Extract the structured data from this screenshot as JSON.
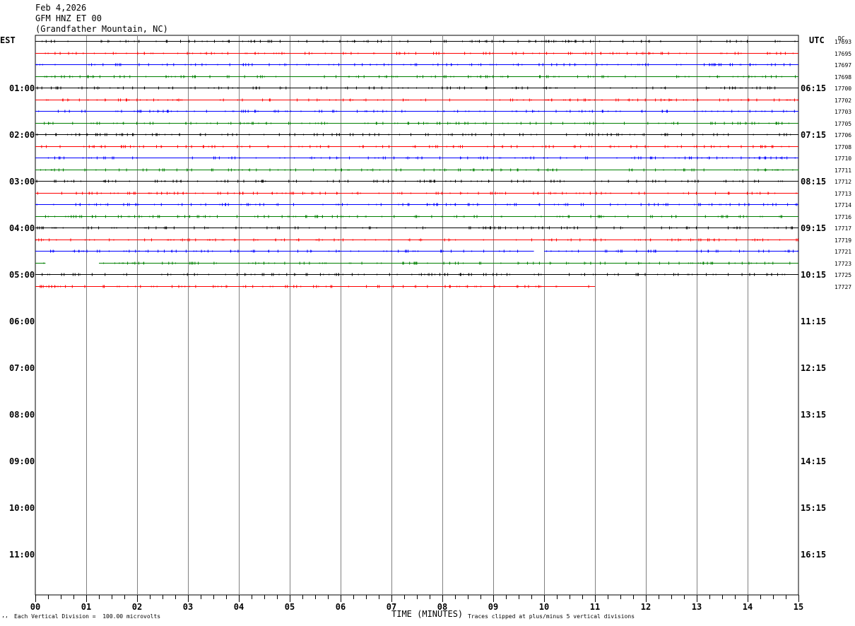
{
  "header": {
    "date": "Feb 4,2026",
    "station": "GFM HNZ ET 00",
    "location": "(Grandfather Mountain, NC)"
  },
  "left_axis_label": "EST",
  "right_axis_label": "UTC",
  "dc_label": "DC",
  "footer": {
    "vertical_division": "Each Vertical Division =  100.00 microvolts",
    "x_title": "TIME (MINUTES)",
    "clip_note": "Traces clipped at plus/minus 5 vertical divisions",
    "corner_mark": "’‘"
  },
  "colors": {
    "black": "#000000",
    "red": "#ff0000",
    "blue": "#0000ff",
    "green": "#008000",
    "grid": "#808080"
  },
  "chart_data": {
    "type": "line",
    "title": "GFM HNZ ET 00",
    "xlabel": "TIME (MINUTES)",
    "xlim": [
      0,
      15
    ],
    "x_ticks": [
      "00",
      "01",
      "02",
      "03",
      "04",
      "05",
      "06",
      "07",
      "08",
      "09",
      "10",
      "11",
      "12",
      "13",
      "14",
      "15"
    ],
    "hours_est": [
      "01:00",
      "02:00",
      "03:00",
      "04:00",
      "05:00",
      "06:00",
      "07:00",
      "08:00",
      "09:00",
      "10:00",
      "11:00"
    ],
    "hours_utc": [
      "06:15",
      "07:15",
      "08:15",
      "09:15",
      "10:15",
      "11:15",
      "12:15",
      "13:15",
      "14:15",
      "15:15",
      "16:15"
    ],
    "trace_color_cycle": [
      "black",
      "red",
      "blue",
      "green"
    ],
    "traces": [
      {
        "dc": "17693",
        "gaps": []
      },
      {
        "dc": "17695",
        "gaps": []
      },
      {
        "dc": "17697",
        "gaps": []
      },
      {
        "dc": "17698",
        "gaps": []
      },
      {
        "dc": "17700",
        "gaps": []
      },
      {
        "dc": "17702",
        "gaps": []
      },
      {
        "dc": "17703",
        "gaps": []
      },
      {
        "dc": "17705",
        "gaps": []
      },
      {
        "dc": "17706",
        "gaps": []
      },
      {
        "dc": "17708",
        "gaps": []
      },
      {
        "dc": "17710",
        "gaps": []
      },
      {
        "dc": "17711",
        "gaps": []
      },
      {
        "dc": "17712",
        "gaps": []
      },
      {
        "dc": "17713",
        "gaps": []
      },
      {
        "dc": "17714",
        "gaps": []
      },
      {
        "dc": "17716",
        "gaps": []
      },
      {
        "dc": "17717",
        "gaps": []
      },
      {
        "dc": "17719",
        "gaps": []
      },
      {
        "dc": "17721",
        "gaps": [
          [
            9.8,
            10.0
          ]
        ]
      },
      {
        "dc": "17723",
        "gaps": [
          [
            0.2,
            1.25
          ]
        ]
      },
      {
        "dc": "17725",
        "gaps": []
      },
      {
        "dc": "17727",
        "end": 11.0,
        "gaps": []
      }
    ]
  }
}
